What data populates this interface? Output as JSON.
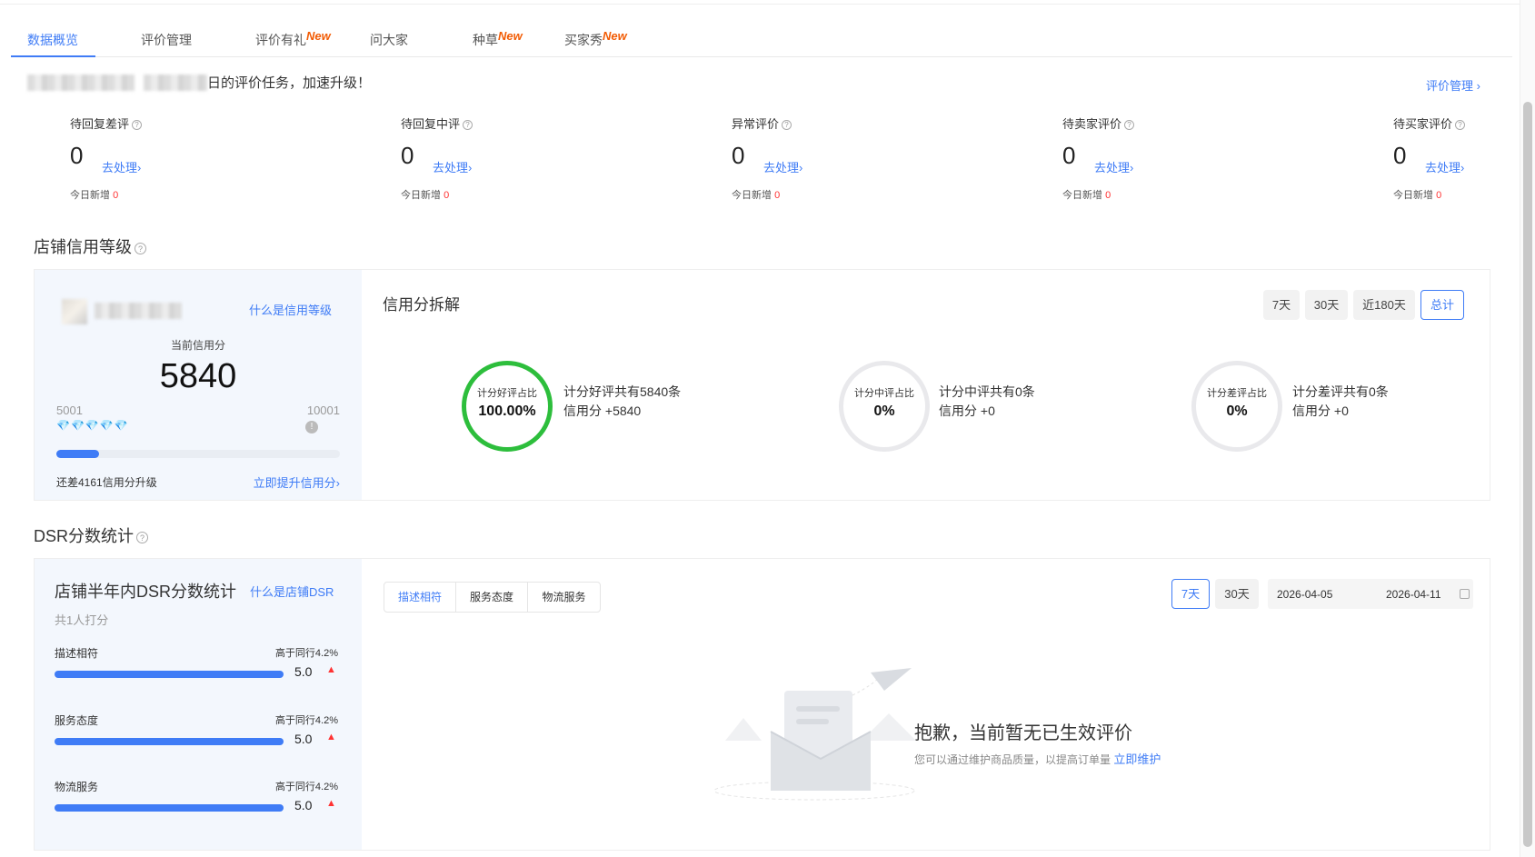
{
  "tabs": [
    {
      "label": "数据概览",
      "new": ""
    },
    {
      "label": "评价管理",
      "new": ""
    },
    {
      "label": "评价有礼",
      "new": "New"
    },
    {
      "label": "问大家",
      "new": ""
    },
    {
      "label": "种草",
      "new": "New"
    },
    {
      "label": "买家秀",
      "new": "New"
    }
  ],
  "notice": {
    "text": "日的评价任务，加速升级！",
    "manage_link": "评价管理 ›"
  },
  "stats": [
    {
      "label": "待回复差评",
      "value": "0",
      "action": "去处理›",
      "today_label": "今日新增",
      "today_value": "0"
    },
    {
      "label": "待回复中评",
      "value": "0",
      "action": "去处理›",
      "today_label": "今日新增",
      "today_value": "0"
    },
    {
      "label": "异常评价",
      "value": "0",
      "action": "去处理›",
      "today_label": "今日新增",
      "today_value": "0"
    },
    {
      "label": "待卖家评价",
      "value": "0",
      "action": "去处理›",
      "today_label": "今日新增",
      "today_value": "0"
    },
    {
      "label": "待买家评价",
      "value": "0",
      "action": "去处理›",
      "today_label": "今日新增",
      "today_value": "0"
    }
  ],
  "credit": {
    "section_title": "店铺信用等级",
    "what_link": "什么是信用等级",
    "current_label": "当前信用分",
    "score": "5840",
    "range_low": "5001",
    "range_high": "10001",
    "diamonds": "💎💎💎💎💎",
    "progress": 0.15,
    "upgrade_text": "还差4161信用分升级",
    "improve_link": "立即提升信用分›"
  },
  "breakdown": {
    "title": "信用分拆解",
    "periods": [
      "7天",
      "30天",
      "近180天",
      "总计"
    ],
    "active_period": "总计",
    "items": [
      {
        "ring_label": "计分好评占比",
        "ring_value": "100.00%",
        "line1": "计分好评共有5840条",
        "line2": "信用分 +5840"
      },
      {
        "ring_label": "计分中评占比",
        "ring_value": "0%",
        "line1": "计分中评共有0条",
        "line2": "信用分 +0"
      },
      {
        "ring_label": "计分差评占比",
        "ring_value": "0%",
        "line1": "计分差评共有0条",
        "line2": "信用分 +0"
      }
    ]
  },
  "dsr": {
    "section_title": "DSR分数统计",
    "card_title": "店铺半年内DSR分数统计",
    "what_link": "什么是店铺DSR",
    "count_text": "共1人打分",
    "rows": [
      {
        "name": "描述相符",
        "compare": "高于同行4.2%",
        "score": "5.0",
        "trend": "▲"
      },
      {
        "name": "服务态度",
        "compare": "高于同行4.2%",
        "score": "5.0",
        "trend": "▲"
      },
      {
        "name": "物流服务",
        "compare": "高于同行4.2%",
        "score": "5.0",
        "trend": "▲"
      }
    ],
    "segments": [
      "描述相符",
      "服务态度",
      "物流服务"
    ],
    "periods": [
      "7天",
      "30天"
    ],
    "date_start": "2026-04-05",
    "date_end": "2026-04-11",
    "empty_title": "抱歉，当前暂无已生效评价",
    "empty_sub": "您可以通过维护商品质量，以提高订单量",
    "empty_link": "立即维护"
  },
  "colors": {
    "accent": "#3f7cf6",
    "good": "#2dbe3c",
    "alert": "#ff3333",
    "new": "#f25c05"
  }
}
